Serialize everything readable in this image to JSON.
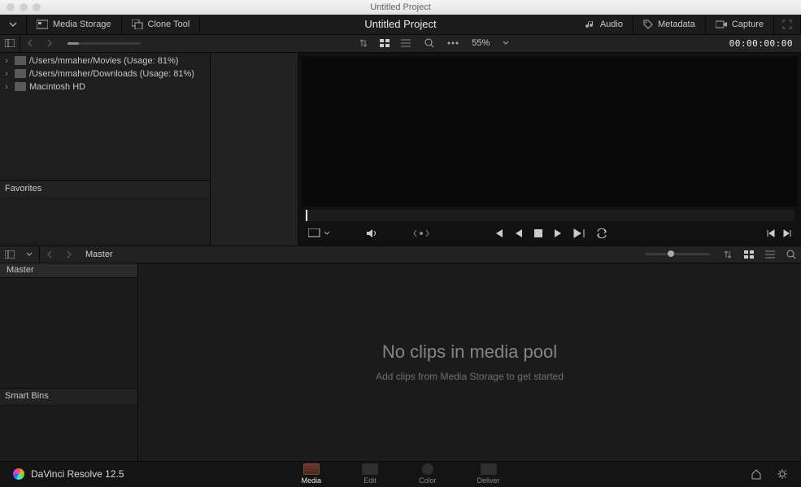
{
  "titlebar": {
    "title": "Untitled Project"
  },
  "toolbar": {
    "media_storage": "Media Storage",
    "clone_tool": "Clone Tool",
    "title": "Untitled Project",
    "audio": "Audio",
    "metadata": "Metadata",
    "capture": "Capture"
  },
  "secondary": {
    "zoom": "55%",
    "timecode": "00:00:00:00"
  },
  "tree": {
    "items": [
      {
        "label": "/Users/mmaher/Movies (Usage: 81%)"
      },
      {
        "label": "/Users/mmaher/Downloads (Usage: 81%)"
      },
      {
        "label": "Macintosh HD"
      }
    ],
    "favorites": "Favorites"
  },
  "poolbar": {
    "master": "Master"
  },
  "bins": {
    "master": "Master",
    "smart": "Smart Bins"
  },
  "pool": {
    "empty_title": "No clips in media pool",
    "empty_sub": "Add clips from Media Storage to get started"
  },
  "bottom": {
    "app": "DaVinci Resolve 12.5",
    "tabs": {
      "media": "Media",
      "edit": "Edit",
      "color": "Color",
      "deliver": "Deliver"
    }
  }
}
